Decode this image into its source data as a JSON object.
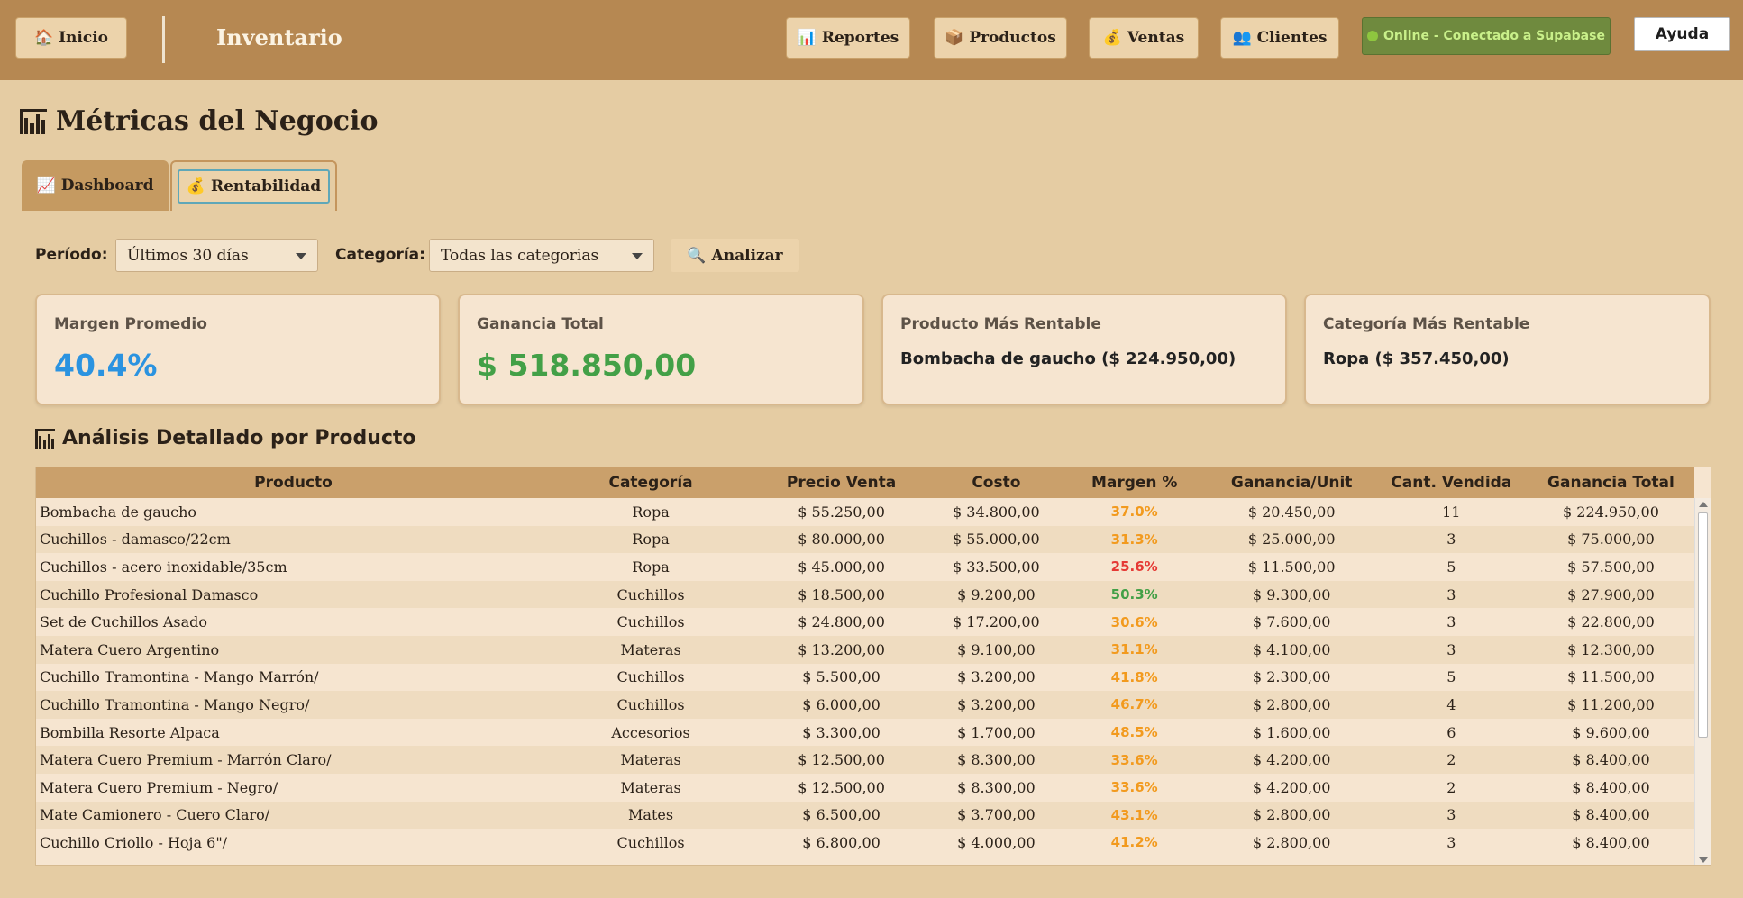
{
  "nav": {
    "home_label": "🏠 Inicio",
    "app_title": "Inventario",
    "reports_label": "📊 Reportes",
    "products_label": "📦 Productos",
    "sales_label": "💰 Ventas",
    "clients_label": "👥 Clientes",
    "status_label": "Online - Conectado a Supabase",
    "help_label": "Ayuda"
  },
  "page": {
    "title": "Métricas del Negocio"
  },
  "tabs": [
    {
      "label": "Dashboard",
      "icon": "chart-line-icon",
      "icon_glyph": "📈"
    },
    {
      "label": "Rentabilidad",
      "icon": "money-bag-icon",
      "icon_glyph": "💰"
    }
  ],
  "filters": {
    "period_label": "Período:",
    "period_value": "Últimos 30 días",
    "category_label": "Categoría:",
    "category_value": "Todas las categorias",
    "analyze_label": "Analizar",
    "analyze_glyph": "🔍"
  },
  "cards": {
    "avg_margin_label": "Margen Promedio",
    "avg_margin_value": "40.4%",
    "total_profit_label": "Ganancia Total",
    "total_profit_value": "$ 518.850,00",
    "top_product_label": "Producto Más Rentable",
    "top_product_value": "Bombacha de gaucho ($ 224.950,00)",
    "top_category_label": "Categoría Más Rentable",
    "top_category_value": "Ropa ($ 357.450,00)"
  },
  "section": {
    "title": "Análisis Detallado por Producto"
  },
  "table": {
    "columns": [
      "Producto",
      "Categoría",
      "Precio Venta",
      "Costo",
      "Margen %",
      "Ganancia/Unit",
      "Cant. Vendida",
      "Ganancia Total"
    ],
    "rows": [
      [
        "Bombacha de gaucho",
        "Ropa",
        "$ 55.250,00",
        "$ 34.800,00",
        "37.0%",
        "$ 20.450,00",
        "11",
        "$ 224.950,00"
      ],
      [
        "Cuchillos - damasco/22cm",
        "Ropa",
        "$ 80.000,00",
        "$ 55.000,00",
        "31.3%",
        "$ 25.000,00",
        "3",
        "$ 75.000,00"
      ],
      [
        "Cuchillos - acero inoxidable/35cm",
        "Ropa",
        "$ 45.000,00",
        "$ 33.500,00",
        "25.6%",
        "$ 11.500,00",
        "5",
        "$ 57.500,00"
      ],
      [
        "Cuchillo Profesional Damasco",
        "Cuchillos",
        "$ 18.500,00",
        "$ 9.200,00",
        "50.3%",
        "$ 9.300,00",
        "3",
        "$ 27.900,00"
      ],
      [
        "Set de Cuchillos Asado",
        "Cuchillos",
        "$ 24.800,00",
        "$ 17.200,00",
        "30.6%",
        "$ 7.600,00",
        "3",
        "$ 22.800,00"
      ],
      [
        "Matera Cuero Argentino",
        "Materas",
        "$ 13.200,00",
        "$ 9.100,00",
        "31.1%",
        "$ 4.100,00",
        "3",
        "$ 12.300,00"
      ],
      [
        "Cuchillo Tramontina - Mango Marrón/",
        "Cuchillos",
        "$ 5.500,00",
        "$ 3.200,00",
        "41.8%",
        "$ 2.300,00",
        "5",
        "$ 11.500,00"
      ],
      [
        "Cuchillo Tramontina - Mango Negro/",
        "Cuchillos",
        "$ 6.000,00",
        "$ 3.200,00",
        "46.7%",
        "$ 2.800,00",
        "4",
        "$ 11.200,00"
      ],
      [
        "Bombilla Resorte Alpaca",
        "Accesorios",
        "$ 3.300,00",
        "$ 1.700,00",
        "48.5%",
        "$ 1.600,00",
        "6",
        "$ 9.600,00"
      ],
      [
        "Matera Cuero Premium - Marrón Claro/",
        "Materas",
        "$ 12.500,00",
        "$ 8.300,00",
        "33.6%",
        "$ 4.200,00",
        "2",
        "$ 8.400,00"
      ],
      [
        "Matera Cuero Premium - Negro/",
        "Materas",
        "$ 12.500,00",
        "$ 8.300,00",
        "33.6%",
        "$ 4.200,00",
        "2",
        "$ 8.400,00"
      ],
      [
        "Mate Camionero - Cuero Claro/",
        "Mates",
        "$ 6.500,00",
        "$ 3.700,00",
        "43.1%",
        "$ 2.800,00",
        "3",
        "$ 8.400,00"
      ],
      [
        "Cuchillo Criollo - Hoja 6\"/",
        "Cuchillos",
        "$ 6.800,00",
        "$ 4.000,00",
        "41.2%",
        "$ 2.800,00",
        "3",
        "$ 8.400,00"
      ]
    ],
    "margin_colors": [
      "#f29a1e",
      "#f29a1e",
      "#e53935",
      "#43a047",
      "#f29a1e",
      "#f29a1e",
      "#f29a1e",
      "#f29a1e",
      "#f29a1e",
      "#f29a1e",
      "#f29a1e",
      "#f29a1e",
      "#f29a1e"
    ]
  },
  "colors": {
    "accent_blue": "#2b93e0",
    "accent_green": "#43a047",
    "topbar": "#b68852",
    "background": "#e5cca3"
  }
}
